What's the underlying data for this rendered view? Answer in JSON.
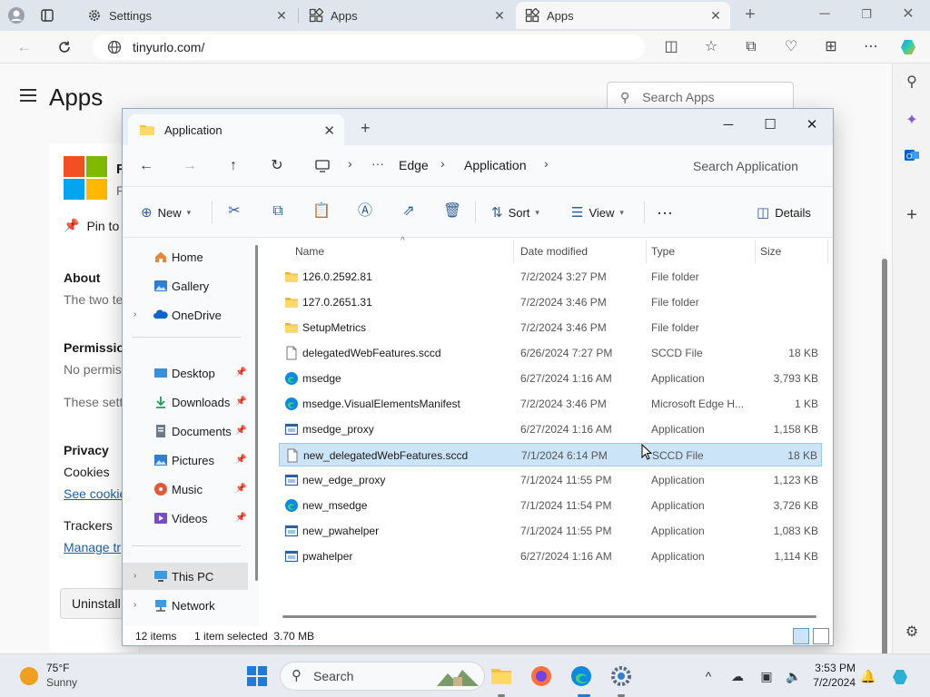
{
  "browser": {
    "tabs": [
      {
        "label": "Settings"
      },
      {
        "label": "Apps"
      },
      {
        "label": "Apps"
      }
    ],
    "url": "tinyurlo.com/"
  },
  "settings_page": {
    "title": "Apps",
    "search_placeholder": "Search Apps",
    "app_name_initial": "R",
    "app_sub_initial": "R",
    "pin_label": "Pin to",
    "about_heading": "About",
    "about_text": "The two te",
    "permissions_heading": "Permission",
    "permissions_text": "No permis",
    "these_settings": "These setti",
    "privacy_heading": "Privacy",
    "cookies_label": "Cookies",
    "see_cookies": "See cookie",
    "trackers_label": "Trackers",
    "manage_trackers": "Manage tr",
    "uninstall_label": "Uninstall"
  },
  "explorer": {
    "tab_title": "Application",
    "breadcrumb": [
      "Edge",
      "Application"
    ],
    "search_placeholder": "Search Application",
    "commands": {
      "new": "New",
      "sort": "Sort",
      "view": "View",
      "details": "Details"
    },
    "nav": {
      "home": "Home",
      "gallery": "Gallery",
      "onedrive": "OneDrive",
      "desktop": "Desktop",
      "downloads": "Downloads",
      "documents": "Documents",
      "pictures": "Pictures",
      "music": "Music",
      "videos": "Videos",
      "this_pc": "This PC",
      "network": "Network"
    },
    "columns": {
      "name": "Name",
      "date": "Date modified",
      "type": "Type",
      "size": "Size"
    },
    "files": [
      {
        "name": "126.0.2592.81",
        "date": "7/2/2024 3:27 PM",
        "type": "File folder",
        "size": "",
        "icon": "folder-icon"
      },
      {
        "name": "127.0.2651.31",
        "date": "7/2/2024 3:46 PM",
        "type": "File folder",
        "size": "",
        "icon": "folder-icon"
      },
      {
        "name": "SetupMetrics",
        "date": "7/2/2024 3:46 PM",
        "type": "File folder",
        "size": "",
        "icon": "folder-icon"
      },
      {
        "name": "delegatedWebFeatures.sccd",
        "date": "6/26/2024 7:27 PM",
        "type": "SCCD File",
        "size": "18 KB",
        "icon": "file-icon"
      },
      {
        "name": "msedge",
        "date": "6/27/2024 1:16 AM",
        "type": "Application",
        "size": "3,793 KB",
        "icon": "edge-icon"
      },
      {
        "name": "msedge.VisualElementsManifest",
        "date": "7/2/2024 3:46 PM",
        "type": "Microsoft Edge H...",
        "size": "1 KB",
        "icon": "edge-icon"
      },
      {
        "name": "msedge_proxy",
        "date": "6/27/2024 1:16 AM",
        "type": "Application",
        "size": "1,158 KB",
        "icon": "app-icon"
      },
      {
        "name": "new_delegatedWebFeatures.sccd",
        "date": "7/1/2024 6:14 PM",
        "type": "SCCD File",
        "size": "18 KB",
        "icon": "file-icon",
        "selected": true
      },
      {
        "name": "new_edge_proxy",
        "date": "7/1/2024 11:55 PM",
        "type": "Application",
        "size": "1,123 KB",
        "icon": "app-icon"
      },
      {
        "name": "new_msedge",
        "date": "7/1/2024 11:54 PM",
        "type": "Application",
        "size": "3,726 KB",
        "icon": "edge-icon"
      },
      {
        "name": "new_pwahelper",
        "date": "7/1/2024 11:55 PM",
        "type": "Application",
        "size": "1,083 KB",
        "icon": "app-icon"
      },
      {
        "name": "pwahelper",
        "date": "6/27/2024 1:16 AM",
        "type": "Application",
        "size": "1,114 KB",
        "icon": "app-icon"
      }
    ],
    "status": {
      "items": "12 items",
      "selected": "1 item selected  3.70 MB"
    }
  },
  "taskbar": {
    "temp": "75°F",
    "condition": "Sunny",
    "search_label": "Search",
    "time": "3:53 PM",
    "date": "7/2/2024"
  },
  "colors": {
    "accent": "#1f7ad8",
    "selection": "#cce4f7",
    "folder": "#f5c242"
  }
}
